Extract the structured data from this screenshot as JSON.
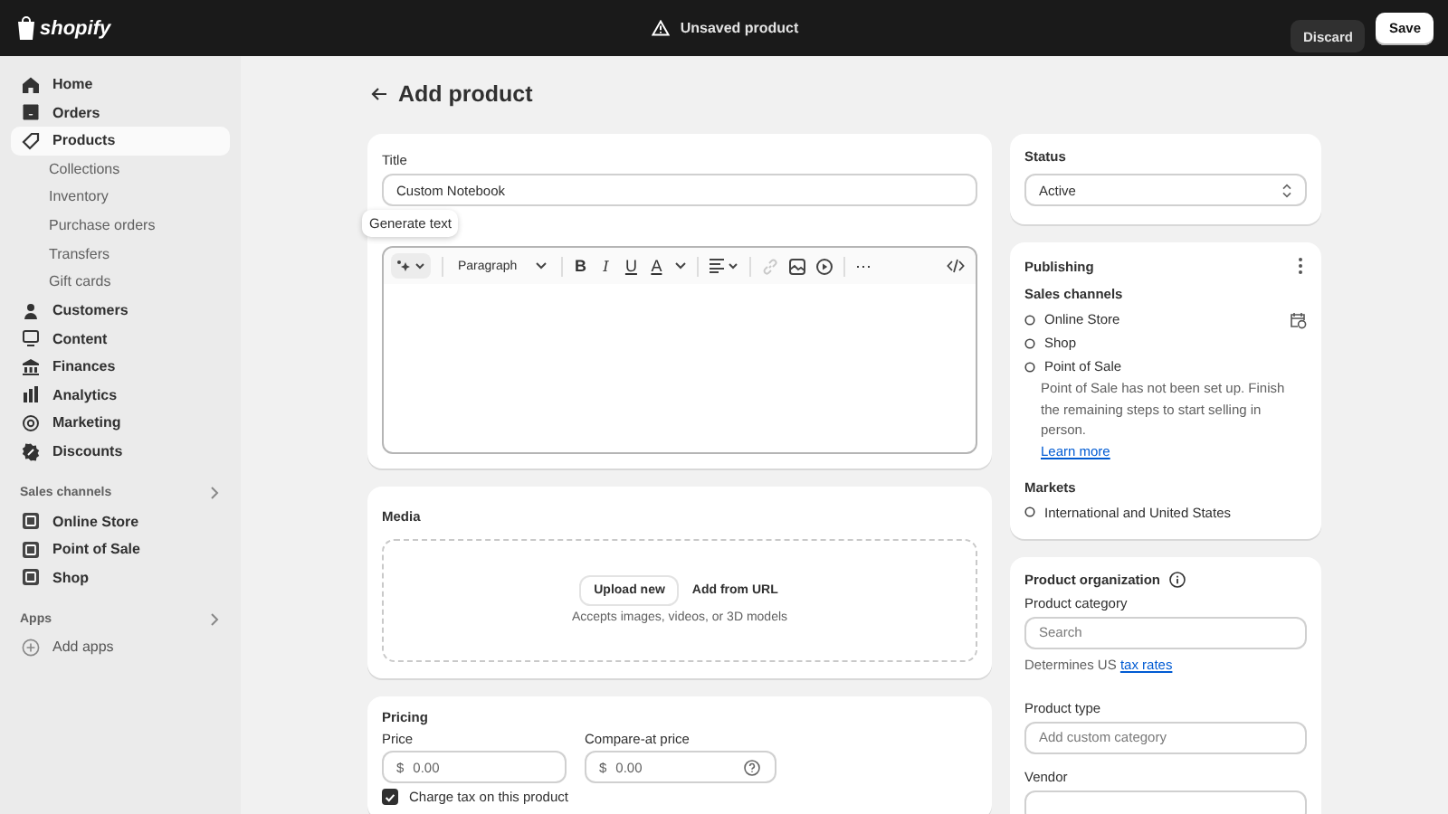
{
  "top_bar": {
    "logo": "shopify",
    "title": "Unsaved product",
    "buttons": [
      {
        "label": "Discard",
        "kind": "secondary"
      },
      {
        "label": "Save",
        "kind": "primary"
      }
    ]
  },
  "sidebar": {
    "items": [
      {
        "label": "Home",
        "selected": false
      },
      {
        "label": "Orders",
        "selected": false
      },
      {
        "label": "Products",
        "selected": true,
        "children": [
          {
            "label": "Collections",
            "selected": false
          },
          {
            "label": "Inventory",
            "selected": false
          },
          {
            "label": "Purchase orders",
            "selected": false
          },
          {
            "label": "Transfers",
            "selected": false
          },
          {
            "label": "Gift cards",
            "selected": false
          }
        ]
      },
      {
        "label": "Customers",
        "selected": false
      },
      {
        "label": "Content",
        "selected": false
      },
      {
        "label": "Finances",
        "selected": false
      },
      {
        "label": "Analytics",
        "selected": false
      },
      {
        "label": "Marketing",
        "selected": false
      },
      {
        "label": "Discounts",
        "selected": false
      }
    ],
    "sections": [
      {
        "heading": "Sales channels",
        "items": [
          {
            "label": "Online Store",
            "selected": false
          },
          {
            "label": "Point of Sale",
            "selected": false
          },
          {
            "label": "Shop",
            "selected": false
          }
        ]
      },
      {
        "heading": "Apps",
        "items": [
          {
            "label": "Add apps",
            "selected": false
          }
        ]
      }
    ]
  },
  "page_title": "Add product",
  "title_card": {
    "label": "Title",
    "value": "Custom Notebook",
    "tooltip": "Generate text",
    "toolbar": {
      "paragraph": "Paragraph",
      "format_buttons": [
        "B",
        "I",
        "U",
        "A"
      ],
      "link_disabled": true,
      "more": "⋯"
    }
  },
  "media": {
    "heading": "Media",
    "upload_button": "Upload new",
    "url_button": "Add from URL",
    "hint": "Accepts images, videos, or 3D models"
  },
  "pricing": {
    "heading": "Pricing",
    "fields": [
      {
        "label": "Price",
        "prefix": "$",
        "placeholder": "0.00",
        "help": false
      },
      {
        "label": "Compare-at price",
        "prefix": "$",
        "placeholder": "0.00",
        "help": true
      }
    ],
    "charge_tax": {
      "label": "Charge tax on this product",
      "checked": true
    }
  },
  "status": {
    "heading": "Status",
    "value": "Active"
  },
  "publishing": {
    "heading": "Publishing",
    "channels_label": "Sales channels",
    "channels": [
      {
        "name": "Online Store",
        "schedule": true
      },
      {
        "name": "Shop",
        "schedule": false
      },
      {
        "name": "Point of Sale",
        "schedule": false,
        "note": "Point of Sale has not been set up. Finish the remaining steps to start selling in person.",
        "link": "Learn more"
      }
    ],
    "markets_label": "Markets",
    "markets": [
      {
        "name": "International and United States"
      }
    ]
  },
  "organization": {
    "heading": "Product organization",
    "category_label": "Product category",
    "category_placeholder": "Search",
    "category_help": "Determines US ",
    "category_link": "tax rates",
    "type_label": "Product type",
    "type_placeholder": "Add custom category",
    "vendor_label": "Vendor"
  }
}
